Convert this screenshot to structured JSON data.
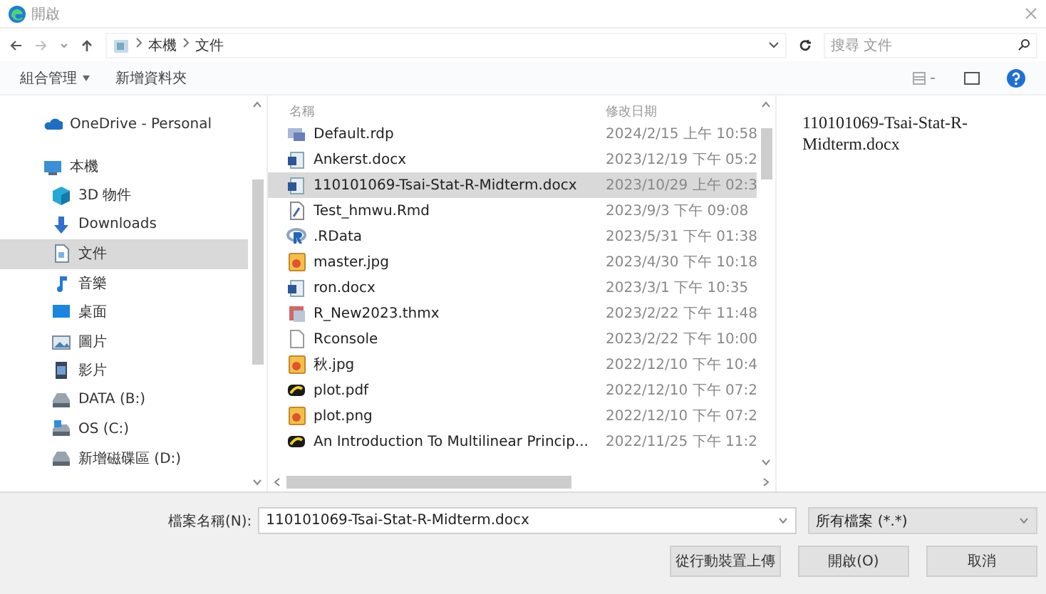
{
  "window": {
    "title": "開啟"
  },
  "address": {
    "path": [
      "本機",
      "文件"
    ],
    "search_placeholder": "搜尋 文件"
  },
  "toolbar": {
    "organize": "組合管理",
    "new_folder": "新增資料夾"
  },
  "navigation": [
    {
      "label": "OneDrive - Personal",
      "kind": "cloud",
      "selected": false
    },
    {
      "label": "本機",
      "kind": "pc",
      "selected": false,
      "children": [
        {
          "label": "3D 物件",
          "kind": "cube",
          "selected": false
        },
        {
          "label": "Downloads",
          "kind": "download",
          "selected": false
        },
        {
          "label": "文件",
          "kind": "doc",
          "selected": true
        },
        {
          "label": "音樂",
          "kind": "music",
          "selected": false
        },
        {
          "label": "桌面",
          "kind": "desktop",
          "selected": false
        },
        {
          "label": "圖片",
          "kind": "pictures",
          "selected": false
        },
        {
          "label": "影片",
          "kind": "video",
          "selected": false
        },
        {
          "label": "DATA (B:)",
          "kind": "drive",
          "selected": false
        },
        {
          "label": "OS (C:)",
          "kind": "osdrive",
          "selected": false
        },
        {
          "label": "新增磁碟區 (D:)",
          "kind": "drive",
          "selected": false
        }
      ]
    }
  ],
  "file_list": {
    "columns": [
      "名稱",
      "修改日期"
    ],
    "rows": [
      {
        "name": "Default.rdp",
        "date": "2024/2/15 上午 10:58",
        "kind": "rdp",
        "selected": false
      },
      {
        "name": "Ankerst.docx",
        "date": "2023/12/19 下午 05:2",
        "kind": "docx",
        "selected": false
      },
      {
        "name": "110101069-Tsai-Stat-R-Midterm.docx",
        "date": "2023/10/29 上午 02:3",
        "kind": "docx",
        "selected": true
      },
      {
        "name": "Test_hmwu.Rmd",
        "date": "2023/9/3 下午 09:08",
        "kind": "rmd",
        "selected": false
      },
      {
        "name": ".RData",
        "date": "2023/5/31 下午 01:38",
        "kind": "rdata",
        "selected": false
      },
      {
        "name": "master.jpg",
        "date": "2023/4/30 下午 10:18",
        "kind": "image",
        "selected": false
      },
      {
        "name": "ron.docx",
        "date": "2023/3/1 下午 10:35",
        "kind": "docx",
        "selected": false
      },
      {
        "name": "R_New2023.thmx",
        "date": "2023/2/22 下午 11:48",
        "kind": "thmx",
        "selected": false
      },
      {
        "name": "Rconsole",
        "date": "2023/2/22 下午 10:00",
        "kind": "blank",
        "selected": false
      },
      {
        "name": "秋.jpg",
        "date": "2022/12/10 下午 10:4",
        "kind": "image",
        "selected": false
      },
      {
        "name": "plot.pdf",
        "date": "2022/12/10 下午 07:2",
        "kind": "pdf",
        "selected": false
      },
      {
        "name": "plot.png",
        "date": "2022/12/10 下午 07:2",
        "kind": "image",
        "selected": false
      },
      {
        "name": "An Introduction To Multilinear Princip...",
        "date": "2022/11/25 下午 11:2",
        "kind": "pdf",
        "selected": false
      }
    ]
  },
  "preview": {
    "text": "110101069-Tsai-Stat-R-Midterm.docx"
  },
  "footer": {
    "filename_label": "檔案名稱(N):",
    "filename": "110101069-Tsai-Stat-R-Midterm.docx",
    "filter": "所有檔案 (*.*)",
    "buttons": [
      "從行動裝置上傳",
      "開啟(O)",
      "取消"
    ]
  }
}
